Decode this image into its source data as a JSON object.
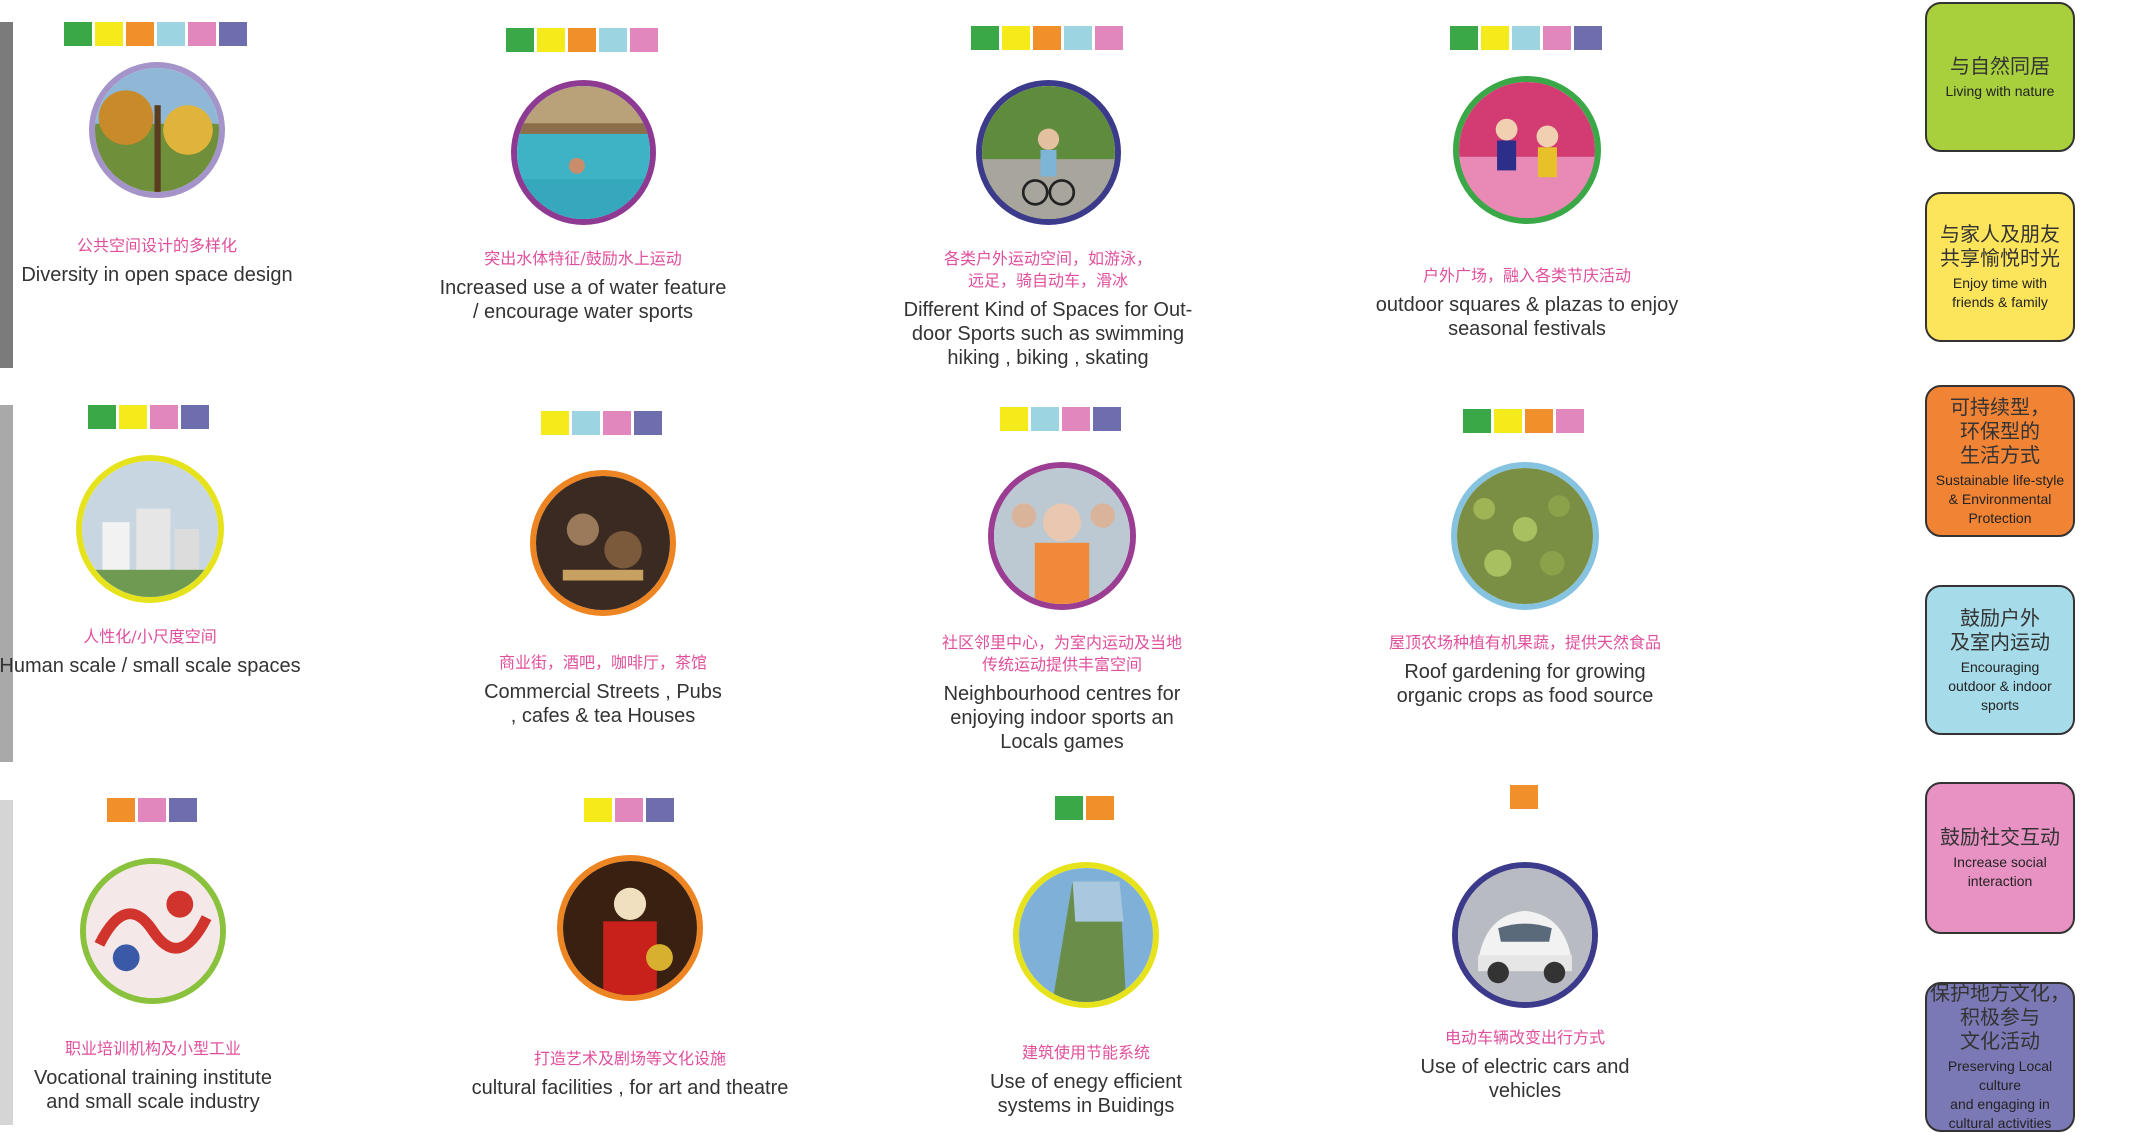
{
  "colors": {
    "green": "#3aa846",
    "yellow": "#f5eb1a",
    "orange": "#f18f2b",
    "lightblue": "#9dd4e2",
    "pink": "#e287bd",
    "purple": "#6e6eaf"
  },
  "legend": [
    {
      "cn": "与自然同居",
      "en": "Living with nature",
      "color": "#a8cf3c"
    },
    {
      "cn": "与家人及朋友\n共享愉悦时光",
      "en": "Enjoy time with\nfriends & family",
      "color": "#fde55b"
    },
    {
      "cn": "可持续型，\n环保型的\n生活方式",
      "en": "Sustainable life-style\n& Environmental\nProtection",
      "color": "#f18335"
    },
    {
      "cn": "鼓励户外\n及室内运动",
      "en": "Encouraging\noutdoor  & indoor\nsports",
      "color": "#a6dbe9"
    },
    {
      "cn": "鼓励社交互动",
      "en": "Increase social\ninteraction",
      "color": "#e892c4"
    },
    {
      "cn": "保护地方文化，\n积极参与\n文化活动",
      "en": "Preserving Local culture\nand engaging in\ncultural activities",
      "color": "#7b79b5"
    }
  ],
  "items": [
    {
      "cn": "公共空间设计的多样化",
      "en": "Diversity in open space design",
      "swatches": [
        "green",
        "yellow",
        "orange",
        "lightblue",
        "pink",
        "purple"
      ],
      "ring": "#a594c9",
      "icon": "forest-lake-photo"
    },
    {
      "cn": "突出水体特征/鼓励水上运动",
      "en": "Increased use  a  of water feature\n/ encourage water sports",
      "swatches": [
        "green",
        "yellow",
        "orange",
        "lightblue",
        "pink"
      ],
      "ring": "#8e3a93",
      "icon": "pool-photo"
    },
    {
      "cn": "各类户外运动空间，如游泳，\n远足，骑自动车，滑冰",
      "en": "Different Kind of Spaces for Out-\ndoor Sports such as swimming\nhiking , biking , skating",
      "swatches": [
        "green",
        "yellow",
        "orange",
        "lightblue",
        "pink"
      ],
      "ring": "#3c3a8a",
      "icon": "cyclists-photo"
    },
    {
      "cn": "户外广场，融入各类节庆活动",
      "en": "outdoor squares  & plazas to enjoy\nseasonal festivals",
      "swatches": [
        "green",
        "yellow",
        "lightblue",
        "pink",
        "purple"
      ],
      "ring": "#3aa846",
      "icon": "festival-photo"
    },
    {
      "cn": "人性化/小尺度空间",
      "en": "Human scale / small scale spaces",
      "swatches": [
        "green",
        "yellow",
        "pink",
        "purple"
      ],
      "ring": "#e6e31c",
      "icon": "buildings-photo"
    },
    {
      "cn": "商业街，酒吧，咖啡厅，茶馆",
      "en": "Commercial Streets , Pubs\n, cafes & tea Houses",
      "swatches": [
        "yellow",
        "lightblue",
        "pink",
        "purple"
      ],
      "ring": "#ee8523",
      "icon": "pub-photo"
    },
    {
      "cn": "社区邻里中心，为室内运动及当地\n传统运动提供丰富空间",
      "en": "Neighbourhood centres for\nenjoying indoor sports an\nLocals games",
      "swatches": [
        "yellow",
        "lightblue",
        "pink",
        "purple"
      ],
      "ring": "#9b3d93",
      "icon": "elderly-game-photo"
    },
    {
      "cn": "屋顶农场种植有机果蔬，提供天然食品",
      "en": "Roof gardening for growing\norganic crops as food source",
      "swatches": [
        "green",
        "yellow",
        "orange",
        "pink"
      ],
      "ring": "#86c3e0",
      "icon": "roof-garden-photo"
    },
    {
      "cn": "职业培训机构及小型工业",
      "en": "Vocational training institute\nand small scale industry",
      "swatches": [
        "orange",
        "pink",
        "purple"
      ],
      "ring": "#8ac13d",
      "icon": "papercut-dragon-photo"
    },
    {
      "cn": "打造艺术及剧场等文化设施",
      "en": "cultural facilities , for art and theatre",
      "swatches": [
        "yellow",
        "pink",
        "purple"
      ],
      "ring": "#ee8523",
      "icon": "opera-photo"
    },
    {
      "cn": "建筑使用节能系统",
      "en": "Use of enegy efficient\nsystems in Buidings",
      "swatches": [
        "green",
        "orange"
      ],
      "ring": "#e6e31c",
      "icon": "green-building-photo"
    },
    {
      "cn": "电动车辆改变出行方式",
      "en": "Use of electric cars and\nvehicles",
      "swatches": [
        "orange"
      ],
      "ring": "#3c3a8a",
      "icon": "electric-car-photo"
    }
  ]
}
